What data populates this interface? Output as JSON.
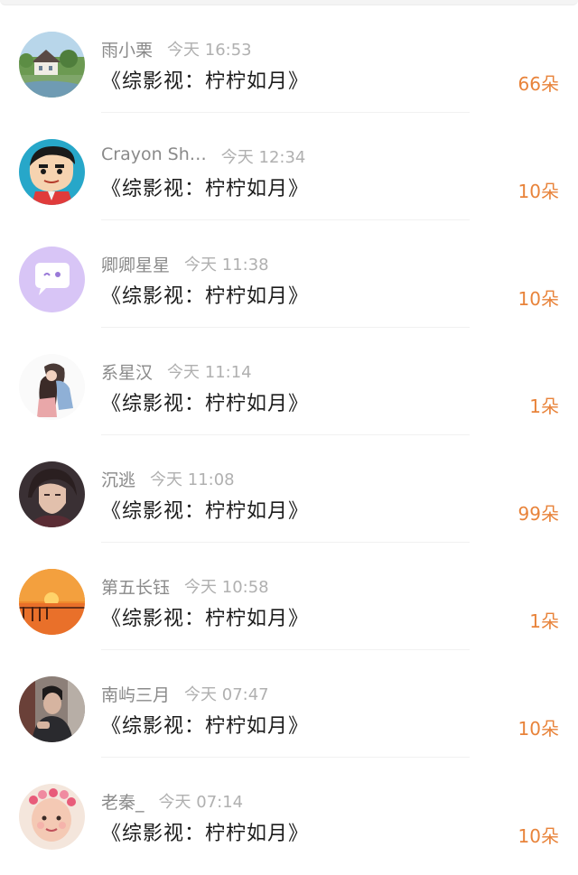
{
  "gifts": [
    {
      "name": "雨小栗",
      "time": "今天 16:53",
      "title": "《综影视：柠柠如月》",
      "amount": "66朵",
      "avatar": "landscape-house-avatar"
    },
    {
      "name": "Crayon Sh…",
      "time": "今天 12:34",
      "title": "《综影视：柠柠如月》",
      "amount": "10朵",
      "avatar": "cartoon-boy-avatar"
    },
    {
      "name": "卿卿星星",
      "time": "今天 11:38",
      "title": "《综影视：柠柠如月》",
      "amount": "10朵",
      "avatar": "purple-chat-avatar"
    },
    {
      "name": "系星汉",
      "time": "今天 11:14",
      "title": "《综影视：柠柠如月》",
      "amount": "1朵",
      "avatar": "couple-illustration-avatar"
    },
    {
      "name": "沉逃",
      "time": "今天 11:08",
      "title": "《综影视：柠柠如月》",
      "amount": "99朵",
      "avatar": "character-portrait-avatar"
    },
    {
      "name": "第五长钰",
      "time": "今天 10:58",
      "title": "《综影视：柠柠如月》",
      "amount": "1朵",
      "avatar": "sunset-pier-avatar"
    },
    {
      "name": "南屿三月",
      "time": "今天 07:47",
      "title": "《综影视：柠柠如月》",
      "amount": "10朵",
      "avatar": "man-photo-avatar"
    },
    {
      "name": "老秦_",
      "time": "今天 07:14",
      "title": "《综影视：柠柠如月》",
      "amount": "10朵",
      "avatar": "child-flower-crown-avatar"
    }
  ],
  "colors": {
    "amount": "#e8833a",
    "name": "#8a8a8a",
    "time": "#b0b0b0",
    "title": "#1c1c1c"
  }
}
